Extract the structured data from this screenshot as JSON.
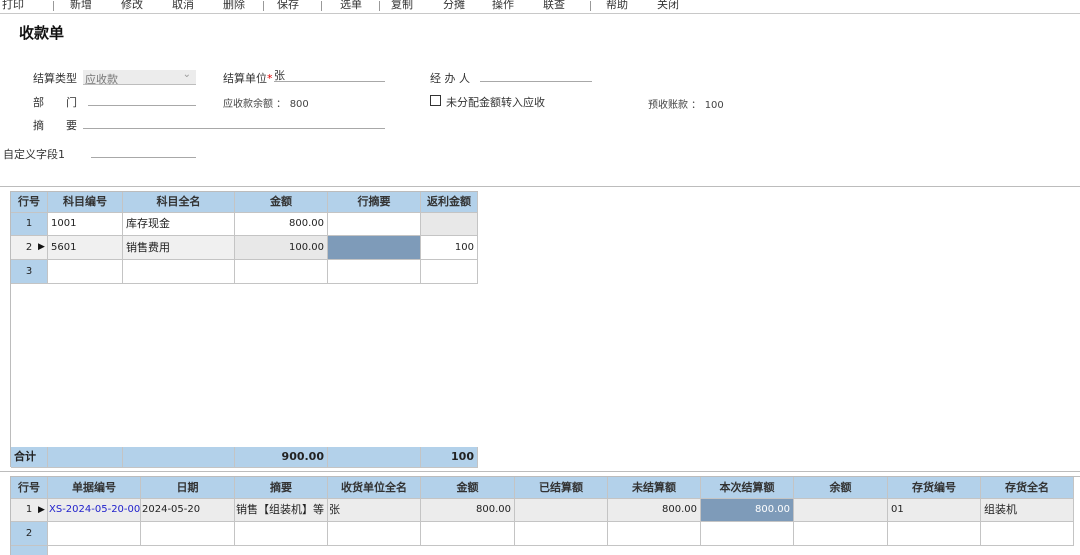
{
  "toolbar": {
    "items": [
      "打印",
      "新增",
      "修改",
      "取消",
      "删除",
      "保存",
      "选单",
      "复制",
      "分摊",
      "操作",
      "联查",
      "帮助",
      "关闭"
    ]
  },
  "form": {
    "title": "收款单",
    "settle_type_label": "结算类型",
    "settle_type_value": "应收款",
    "settle_unit_label": "结算单位",
    "settle_unit_required": "*",
    "settle_unit_value": "张",
    "handler_label": "经 办 人",
    "dept_label": "部　　门",
    "receivable_balance_label": "应收款余额 ：",
    "receivable_balance_value": "800",
    "unallocated_label": "未分配金额转入应收",
    "prepaid_label": "预收账款 ：",
    "prepaid_value": "100",
    "summary_label": "摘　　要",
    "custom_field_label": "自定义字段1"
  },
  "account_grid": {
    "columns": [
      "行号",
      "科目编号",
      "科目全名",
      "金额",
      "行摘要",
      "返利金额"
    ],
    "rows": [
      {
        "no": "1",
        "code": "1001",
        "name": "库存现金",
        "amount": "800.00",
        "memo": "",
        "rebate": ""
      },
      {
        "no": "2",
        "code": "5601",
        "name": "销售费用",
        "amount": "100.00",
        "memo": "",
        "rebate": "100"
      },
      {
        "no": "3",
        "code": "",
        "name": "",
        "amount": "",
        "memo": "",
        "rebate": ""
      }
    ],
    "total_label": "合计",
    "total_amount": "900.00",
    "total_rebate": "100"
  },
  "doc_grid": {
    "columns": [
      "行号",
      "单据编号",
      "日期",
      "摘要",
      "收货单位全名",
      "金额",
      "已结算额",
      "未结算额",
      "本次结算额",
      "余额",
      "存货编号",
      "存货全名"
    ],
    "rows": [
      {
        "no": "1",
        "doc_no": "XS-2024-05-20-00",
        "date": "2024-05-20",
        "summary": "销售【组装机】等",
        "unit": "张",
        "amount": "800.00",
        "settled": "",
        "unsettled": "800.00",
        "current": "800.00",
        "balance": "",
        "inv_code": "01",
        "inv_name": "组装机"
      },
      {
        "no": "2",
        "doc_no": "",
        "date": "",
        "summary": "",
        "unit": "",
        "amount": "",
        "settled": "",
        "unsettled": "",
        "current": "",
        "balance": "",
        "inv_code": "",
        "inv_name": ""
      }
    ]
  },
  "colors": {
    "header_bg": "#b3d1ea",
    "selected_cell": "#7e9bb9",
    "link": "#2222cc"
  }
}
